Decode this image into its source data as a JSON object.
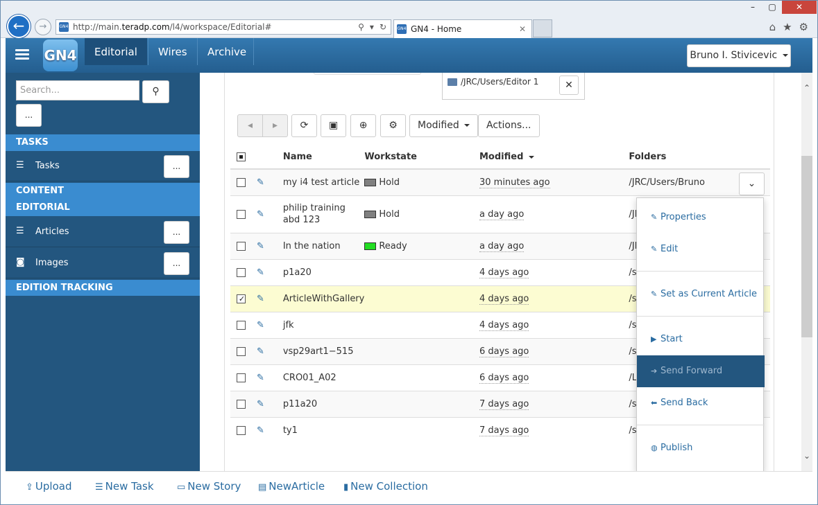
{
  "browser": {
    "url_prefix": "http://main.",
    "url_domain": "teradp.com",
    "url_suffix": "/l4/workspace/Editorial#",
    "tab_title": "GN4 - Home",
    "favicon_text": "GN4",
    "close_tab": "✕"
  },
  "app": {
    "logo_text": "GN4",
    "nav_tabs": [
      {
        "label": "Editorial"
      },
      {
        "label": "Wires"
      },
      {
        "label": "Archive"
      }
    ],
    "user_name": "Bruno I. Stivicevic"
  },
  "sidebar": {
    "search_placeholder": "Search...",
    "dots": "...",
    "sections": [
      {
        "label": "TASKS"
      },
      {
        "label": "CONTENT"
      },
      {
        "label": "EDITORIAL"
      },
      {
        "label": "EDITION TRACKING"
      }
    ],
    "items": [
      {
        "label": "Tasks"
      },
      {
        "label": "Articles"
      },
      {
        "label": "Images"
      }
    ]
  },
  "main": {
    "folder_path": "/JRC/Users/Editor 1",
    "toolbar": {
      "modified_label": "Modified",
      "actions_label": "Actions..."
    },
    "columns": {
      "name": "Name",
      "workstate": "Workstate",
      "modified": "Modified",
      "folders": "Folders"
    },
    "rows": [
      {
        "name": "my i4 test article",
        "workstate": "Hold",
        "modified": "30 minutes ago",
        "folder": "/JRC/Users/Bruno"
      },
      {
        "name": "philip training abd 123",
        "workstate": "Hold",
        "modified": "a day ago",
        "folder": "/JR"
      },
      {
        "name": "In the nation",
        "workstate": "Ready",
        "modified": "a day ago",
        "folder": "/JR"
      },
      {
        "name": "p1a20",
        "workstate": "",
        "modified": "4 days ago",
        "folder": "/s"
      },
      {
        "name": "ArticleWithGallery",
        "workstate": "",
        "modified": "4 days ago",
        "folder": "/s"
      },
      {
        "name": "jfk",
        "workstate": "",
        "modified": "4 days ago",
        "folder": "/s"
      },
      {
        "name": "vsp29art1−515",
        "workstate": "",
        "modified": "6 days ago",
        "folder": "/s"
      },
      {
        "name": "CRO01_A02",
        "workstate": "",
        "modified": "6 days ago",
        "folder": "/L"
      },
      {
        "name": "p11a20",
        "workstate": "",
        "modified": "7 days ago",
        "folder": "/s"
      },
      {
        "name": "ty1",
        "workstate": "",
        "modified": "7 days ago",
        "folder": "/s"
      }
    ],
    "context_menu": {
      "properties": "Properties",
      "edit": "Edit",
      "set_current": "Set as Current Article",
      "start": "Start",
      "send_forward": "Send Forward",
      "send_back": "Send Back",
      "publish": "Publish"
    }
  },
  "footer": {
    "upload": "Upload",
    "new_task": "New Task",
    "new_story": "New Story",
    "new_article": "NewArticle",
    "new_collection": "New Collection"
  },
  "colors": {
    "navbar": "#2a6ca1",
    "sidebar": "#23567f",
    "section_header": "#3a8cd0",
    "hold": "#808080",
    "ready": "#22dd22",
    "selected_row": "#fcfcd2",
    "link": "#2a6ca1"
  }
}
